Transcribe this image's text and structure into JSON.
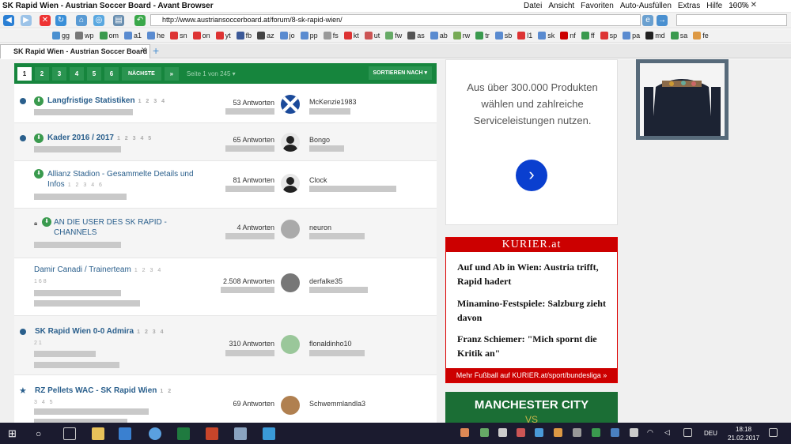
{
  "window": {
    "title": "SK Rapid Wien - Austrian Soccer Board - Avant Browser",
    "menu": [
      "Datei",
      "Ansicht",
      "Favoriten",
      "Auto-Ausfüllen",
      "Extras",
      "Hilfe"
    ],
    "zoom": "100%"
  },
  "address": {
    "url": "http://www.austriansoccerboard.at/forum/8-sk-rapid-wien/"
  },
  "bookmarks": [
    "gg",
    "wp",
    "om",
    "a1",
    "he",
    "sn",
    "on",
    "yt",
    "fb",
    "az",
    "jo",
    "pp",
    "fs",
    "kt",
    "ut",
    "fw",
    "as",
    "ab",
    "rw",
    "tr",
    "sb",
    "l1",
    "sk",
    "nf",
    "ff",
    "sp",
    "pa",
    "md",
    "sa",
    "fe"
  ],
  "tab": {
    "label": "SK Rapid Wien - Austrian Soccer Board"
  },
  "pager": {
    "pages": [
      "1",
      "2",
      "3",
      "4",
      "5",
      "6"
    ],
    "next": "NÄCHSTE",
    "last": "»",
    "info": "Seite 1 von 245",
    "sort": "SORTIEREN NACH"
  },
  "topics": [
    {
      "title": "Langfristige Statistiken",
      "pages": "1 2 3 4",
      "answers": "53 Antworten",
      "user": "McKenzie1983"
    },
    {
      "title": "Kader 2016 / 2017",
      "pages": "1 2 3 4 5",
      "answers": "65 Antworten",
      "user": "Bongo"
    },
    {
      "title": "Allianz Stadion - Gesammelte Details und Infos",
      "pages": "1 2 3 4 6",
      "answers": "81 Antworten",
      "user": "Clock"
    },
    {
      "title": "AN DIE USER DES SK RAPID - CHANNELS",
      "pages": "",
      "answers": "4 Antworten",
      "user": "neuron"
    },
    {
      "title": "Damir Canadi / Trainerteam",
      "pages": "1 2 3 4",
      "pages2": "168",
      "answers": "2.508 Antworten",
      "user": "derfalke35"
    },
    {
      "title": "SK Rapid Wien 0-0 Admira",
      "pages": "1 2 3 4",
      "pages2": "21",
      "answers": "310 Antworten",
      "user": "flonaldinho10"
    },
    {
      "title": "RZ Pellets WAC - SK Rapid Wien",
      "pages": "1 2",
      "pages2": "3 4 5",
      "answers": "69 Antworten",
      "user": "Schwemmlandla3"
    }
  ],
  "ad": {
    "text": "Aus über 300.000 Produkten wählen und zahlreiche Serviceleistungen nutzen.",
    "button": "›"
  },
  "kurier": {
    "brand": "KURIER.at",
    "items": [
      "Auf und Ab in Wien: Austria trifft, Rapid hadert",
      "Minamino-Festspiele: Salzburg zieht davon",
      "Franz Schiemer: \"Mich spornt die Kritik an\""
    ],
    "footer": "Mehr Fußball auf KURIER.at/sport/bundesliga »"
  },
  "manc": {
    "title": "MANCHESTER CITY",
    "sub": "VS"
  },
  "taskbar": {
    "lang": "DEU",
    "time": "18:18",
    "date": "21.02.2017"
  },
  "colors": {
    "green": "#16853d",
    "blue": "#2a5f8c",
    "red": "#c00"
  }
}
